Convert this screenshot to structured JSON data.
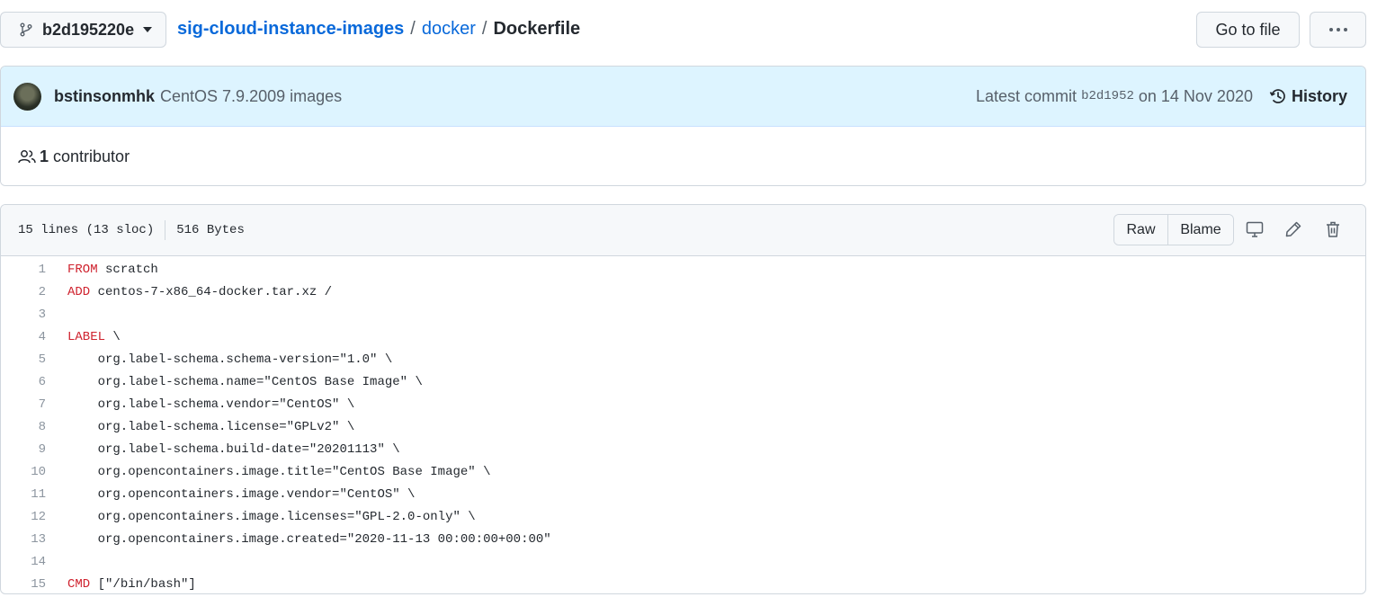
{
  "branch": {
    "name": "b2d195220e",
    "icon": "git-branch-icon"
  },
  "breadcrumb": {
    "repo": "sig-cloud-instance-images",
    "dir": "docker",
    "file": "Dockerfile",
    "separator": "/"
  },
  "actions": {
    "go_to_file": "Go to file",
    "more": "kebab-horizontal-icon"
  },
  "commit": {
    "author": "bstinsonmhk",
    "message": "CentOS 7.9.2009 images",
    "latest_label": "Latest commit",
    "sha": "b2d1952",
    "date_text": "on 14 Nov 2020",
    "history_label": "History"
  },
  "contributors": {
    "count": "1",
    "label": "contributor"
  },
  "file": {
    "lines_info": "15 lines (13 sloc)",
    "size": "516 Bytes",
    "raw_label": "Raw",
    "blame_label": "Blame"
  },
  "code": [
    {
      "n": "1",
      "kw": "FROM",
      "rest": " scratch"
    },
    {
      "n": "2",
      "kw": "ADD",
      "rest": " centos-7-x86_64-docker.tar.xz /"
    },
    {
      "n": "3",
      "kw": "",
      "rest": ""
    },
    {
      "n": "4",
      "kw": "LABEL",
      "rest": " \\"
    },
    {
      "n": "5",
      "kw": "",
      "rest": "    org.label-schema.schema-version=\"1.0\" \\"
    },
    {
      "n": "6",
      "kw": "",
      "rest": "    org.label-schema.name=\"CentOS Base Image\" \\"
    },
    {
      "n": "7",
      "kw": "",
      "rest": "    org.label-schema.vendor=\"CentOS\" \\"
    },
    {
      "n": "8",
      "kw": "",
      "rest": "    org.label-schema.license=\"GPLv2\" \\"
    },
    {
      "n": "9",
      "kw": "",
      "rest": "    org.label-schema.build-date=\"20201113\" \\"
    },
    {
      "n": "10",
      "kw": "",
      "rest": "    org.opencontainers.image.title=\"CentOS Base Image\" \\"
    },
    {
      "n": "11",
      "kw": "",
      "rest": "    org.opencontainers.image.vendor=\"CentOS\" \\"
    },
    {
      "n": "12",
      "kw": "",
      "rest": "    org.opencontainers.image.licenses=\"GPL-2.0-only\" \\"
    },
    {
      "n": "13",
      "kw": "",
      "rest": "    org.opencontainers.image.created=\"2020-11-13 00:00:00+00:00\""
    },
    {
      "n": "14",
      "kw": "",
      "rest": ""
    },
    {
      "n": "15",
      "kw": "CMD",
      "rest": " [\"/bin/bash\"]"
    }
  ]
}
